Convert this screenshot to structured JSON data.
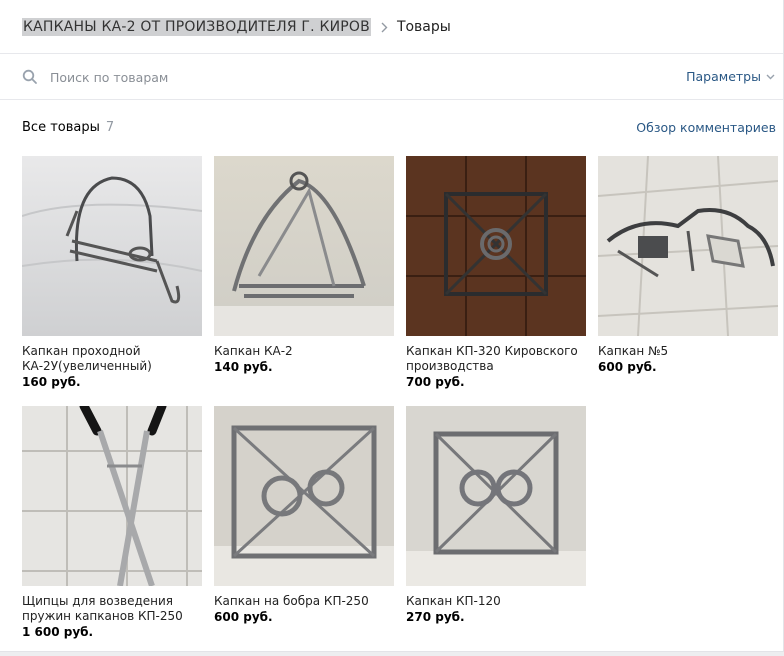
{
  "breadcrumb": {
    "group_name": "КАПКАНЫ КА-2 ОТ ПРОИЗВОДИТЕЛЯ Г. КИРОВ",
    "current": "Товары"
  },
  "search": {
    "placeholder": "Поиск по товарам",
    "value": "",
    "params_label": "Параметры"
  },
  "subheader": {
    "all_label": "Все товары",
    "count": "7",
    "review_link": "Обзор комментариев"
  },
  "colors": {
    "link": "#2a5885",
    "muted": "#939aa3",
    "accent_highlight": "#cfd0d2"
  },
  "products": [
    {
      "title": "Капкан проходной КА-2У(увеличенный)",
      "price": "160 руб."
    },
    {
      "title": "Капкан КА-2",
      "price": "140 руб."
    },
    {
      "title": "Капкан КП-320 Кировского производства",
      "price": "700 руб."
    },
    {
      "title": "Капкан №5",
      "price": "600 руб."
    },
    {
      "title": "Щипцы для возведения пружин капканов КП-250 и...",
      "price": "1 600 руб."
    },
    {
      "title": "Капкан на бобра КП-250",
      "price": "600 руб."
    },
    {
      "title": "Капкан КП-120",
      "price": "270 руб."
    }
  ]
}
